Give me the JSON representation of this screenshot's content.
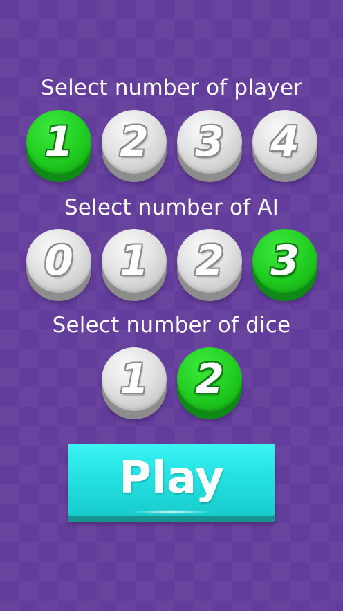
{
  "colors": {
    "background": "#633d9c",
    "selected": "#22cf22",
    "unselected": "#e2e2e2",
    "play": "#25e2e2"
  },
  "players": {
    "label": "Select number of player",
    "options": [
      "1",
      "2",
      "3",
      "4"
    ],
    "selected": "1"
  },
  "ai": {
    "label": "Select number of AI",
    "options": [
      "0",
      "1",
      "2",
      "3"
    ],
    "selected": "3"
  },
  "dice": {
    "label": "Select number of dice",
    "options": [
      "1",
      "2"
    ],
    "selected": "2"
  },
  "play_button": {
    "label": "Play"
  }
}
